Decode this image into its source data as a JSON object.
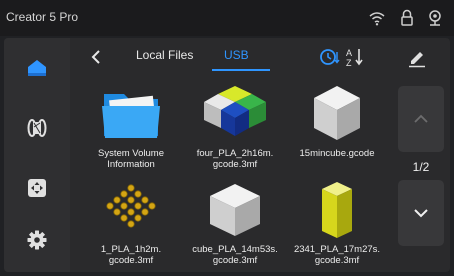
{
  "app": {
    "title": "Creator 5 Pro"
  },
  "statusbar": {
    "icons": [
      "wifi-icon",
      "lock-icon",
      "camera-icon"
    ]
  },
  "sidebar": {
    "items": [
      {
        "name": "home",
        "icon": "home-icon",
        "active": true
      },
      {
        "name": "filament",
        "icon": "filament-spool-icon",
        "active": false
      },
      {
        "name": "move",
        "icon": "move-axes-icon",
        "active": false
      },
      {
        "name": "settings",
        "icon": "gear-icon",
        "active": false
      }
    ]
  },
  "nav": {
    "tabs": [
      {
        "label": "Local Files",
        "active": false
      },
      {
        "label": "USB",
        "active": true
      }
    ],
    "toolbar_icons": [
      "sort-by-time-icon",
      "sort-alpha-icon",
      "edit-pencil-icon"
    ]
  },
  "files": [
    {
      "name": "System Volume\nInformation",
      "thumb": "folder"
    },
    {
      "name": "four_PLA_2h16m.\ngcode.3mf",
      "thumb": "multicolor-cubes"
    },
    {
      "name": "15mincube.gcode",
      "thumb": "gray-cube"
    },
    {
      "name": "1_PLA_1h2m.\ngcode.3mf",
      "thumb": "gold-grid"
    },
    {
      "name": "cube_PLA_14m53s.\ngcode.3mf",
      "thumb": "gray-cube"
    },
    {
      "name": "2341_PLA_17m27s.\ngcode.3mf",
      "thumb": "yellow-block"
    }
  ],
  "pager": {
    "label": "1/2"
  },
  "colors": {
    "accent": "#2f95ff",
    "background": "#202124",
    "panel": "#2a2a2c"
  }
}
